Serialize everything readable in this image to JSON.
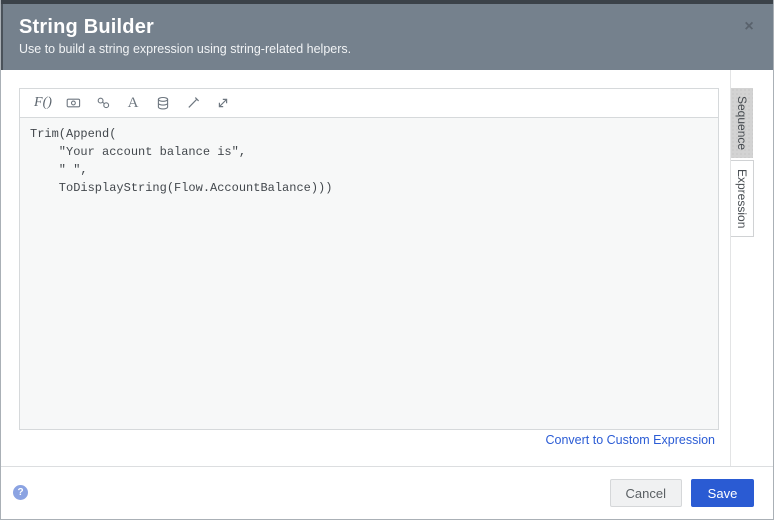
{
  "dialog": {
    "title": "String Builder",
    "subtitle": "Use to build a string expression using string-related helpers.",
    "close_glyph": "×"
  },
  "toolbar": {
    "icons": [
      {
        "name": "function-icon",
        "glyph": "F()"
      },
      {
        "name": "value-token-icon"
      },
      {
        "name": "linked-values-icon"
      },
      {
        "name": "text-icon",
        "glyph": "A"
      },
      {
        "name": "data-source-icon"
      },
      {
        "name": "wand-icon"
      },
      {
        "name": "expand-icon"
      }
    ]
  },
  "editor": {
    "code_lines": [
      "Trim(Append(",
      "    \"Your account balance is\",",
      "    \" \",",
      "    ToDisplayString(Flow.AccountBalance)))"
    ]
  },
  "tabs": [
    {
      "label": "Sequence",
      "selected": true
    },
    {
      "label": "Expression",
      "selected": false
    }
  ],
  "links": {
    "convert_to_custom_expression": "Convert to Custom Expression"
  },
  "footer": {
    "help_glyph": "?",
    "cancel_label": "Cancel",
    "save_label": "Save"
  },
  "colors": {
    "header_bg": "#75818d",
    "top_strip": "#3b4249",
    "save_button_bg": "#2a5bd3",
    "link_blue": "#2b5cd5",
    "selected_tab_bg": "#d3d3d3",
    "code_area_bg": "#f7f8f8",
    "help_badge_bg": "#8ba3e2"
  }
}
